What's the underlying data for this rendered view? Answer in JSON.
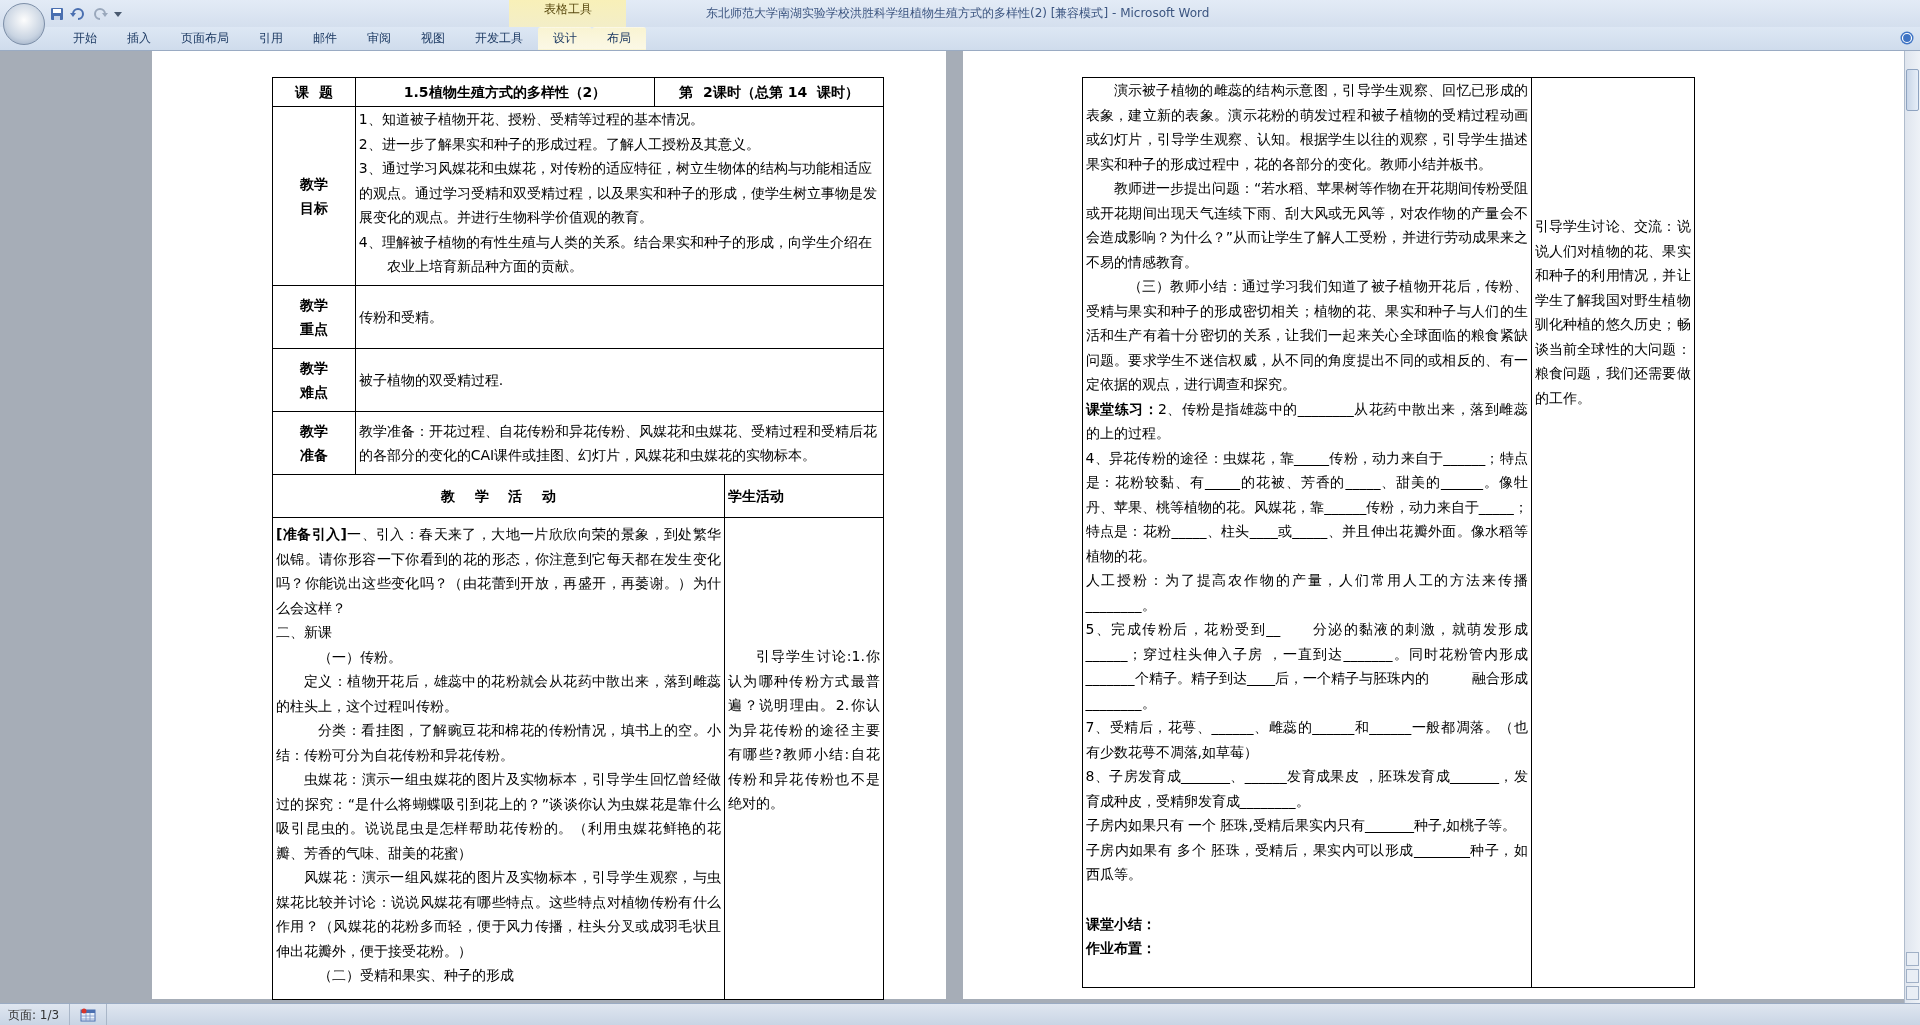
{
  "window": {
    "title": "东北师范大学南湖实验学校洪胜科学组植物生殖方式的多样性(2) [兼容模式] - Microsoft Word"
  },
  "contextual_tab_group": "表格工具",
  "ribbon_tabs": [
    {
      "label": "开始",
      "selected": false
    },
    {
      "label": "插入",
      "selected": false
    },
    {
      "label": "页面布局",
      "selected": false
    },
    {
      "label": "引用",
      "selected": false
    },
    {
      "label": "邮件",
      "selected": false
    },
    {
      "label": "审阅",
      "selected": false
    },
    {
      "label": "视图",
      "selected": false
    },
    {
      "label": "开发工具",
      "selected": false
    },
    {
      "label": "设计",
      "selected": false
    },
    {
      "label": "布局",
      "selected": false
    }
  ],
  "left_page": {
    "topic_label": "课  题",
    "topic": "1.5植物生殖方式的多样性（2）",
    "lesson": "第  2课时（总第 14  课时）",
    "rows": [
      {
        "label": "教学目标",
        "items": [
          "1、知道被子植物开花、授粉、受精等过程的基本情况。",
          "2、进一步了解果实和种子的形成过程。了解人工授粉及其意义。",
          "3、通过学习风媒花和虫媒花，对传粉的适应特征，树立生物体的结构与功能相适应的观点。通过学习受精和双受精过程，以及果实和种子的形成，使学生树立事物是发展变化的观点。并进行生物科学价值观的教育。",
          "4、理解被子植物的有性生殖与人类的关系。结合果实和种子的形成，向学生介绍在农业上培育新品种方面的贡献。"
        ]
      },
      {
        "label": "教学重点",
        "items": [
          "传粉和受精。"
        ]
      },
      {
        "label": "教学难点",
        "items": [
          "被子植物的双受精过程."
        ]
      },
      {
        "label": "教学准备",
        "items": [
          "教学准备：开花过程、自花传粉和异花传粉、风媒花和虫媒花、受精过程和受精后花的各部分的变化的CAI课件或挂图、幻灯片，风媒花和虫媒花的实物标本。"
        ]
      }
    ],
    "activity_header": "教    学    活    动",
    "student_header": "学生活动",
    "activity": [
      {
        "kind": "plain",
        "text": "**[准备引入]**一、引入：春天来了，大地一片欣欣向荣的景象，到处繁华似锦。请你形容一下你看到的花的形态，你注意到它每天都在发生变化吗？你能说出这些变化吗？（由花蕾到开放，再盛开，再萎谢。）为什么会这样？"
      },
      {
        "kind": "plain",
        "text": "二、新课"
      },
      {
        "kind": "indent_deep",
        "text": "（一）传粉。"
      },
      {
        "kind": "indent",
        "text": "定义：植物开花后，雄蕊中的花粉就会从花药中散出来，落到雌蕊的柱头上，这个过程叫传粉。"
      },
      {
        "kind": "indent_deep",
        "text": "分类：看挂图，了解豌豆花和棉花的传粉情况，填书上的空。小结：传粉可分为自花传粉和异花传粉。"
      },
      {
        "kind": "indent",
        "text": "虫媒花：演示一组虫媒花的图片及实物标本，引导学生回忆曾经做过的探究：“是什么将蝴蝶吸引到花上的？”谈谈你认为虫媒花是靠什么吸引昆虫的。说说昆虫是怎样帮助花传粉的。（利用虫媒花鲜艳的花瓣、芳香的气味、甜美的花蜜）"
      },
      {
        "kind": "indent",
        "text": "风媒花：演示一组风媒花的图片及实物标本，引导学生观察，与虫媒花比较并讨论：说说风媒花有哪些特点。这些特点对植物传粉有什么作用？（风媒花的花粉多而轻，便于风力传播，柱头分叉或成羽毛状且伸出花瓣外，便于接受花粉。）"
      },
      {
        "kind": "indent_deep",
        "text": "（二）受精和果实、种子的形成"
      }
    ],
    "student": "引导学生讨论:1.你认为哪种传粉方式最普遍？说明理由。2.你认为异花传粉的途径主要有哪些?教师小结:自花传粉和异花传粉也不是绝对的。"
  },
  "right_page": {
    "activity": [
      {
        "kind": "indent",
        "text": "演示被子植物的雌蕊的结构示意图，引导学生观察、回忆已形成的表象，建立新的表象。演示花粉的萌发过程和被子植物的受精过程动画或幻灯片，引导学生观察、认知。根据学生以往的观察，引导学生描述果实和种子的形成过程中，花的各部分的变化。教师小结并板书。"
      },
      {
        "kind": "indent",
        "text": "教师进一步提出问题：“若水稻、苹果树等作物在开花期间传粉受阻或开花期间出现天气连续下雨、刮大风或无风等，对农作物的产量会不会造成影响？为什么？”从而让学生了解人工受粉，并进行劳动成果来之不易的情感教育。"
      },
      {
        "kind": "indent_deep",
        "text": "（三）教师小结：通过学习我们知道了被子植物开花后，传粉、受精与果实和种子的形成密切相关；植物的花、果实和种子与人们的生活和生产有着十分密切的关系，让我们一起来关心全球面临的粮食紧缺问题。要求学生不迷信权威，从不同的角度提出不同的或相反的、有一定依据的观点，进行调查和探究。"
      },
      {
        "kind": "plain",
        "text": "**课堂练习：**2、传粉是指雄蕊中的________从花药中散出来，落到雌蕊的上的过程。"
      },
      {
        "kind": "plain",
        "text": "4、异花传粉的途径：虫媒花，靠_____传粉，动力来自于______；特点是：花粉较黏、有_____的花被、芳香的_____、甜美的______。像牡丹、苹果、桃等植物的花。风媒花，靠______传粉，动力来自于_____；特点是：花粉_____、柱头____或_____、并且伸出花瓣外面。像水稻等植物的花。"
      },
      {
        "kind": "plain",
        "text": "人工授粉：为了提高农作物的产量，人们常用人工的方法来传播________。"
      },
      {
        "kind": "plain",
        "text": "5、完成传粉后，花粉受到__　　分泌的黏液的刺激，就萌发形成______；穿过柱头伸入子房 ，一直到达_______。同时花粉管内形成_______个精子。精子到达____后，一个精子与胚珠内的　　　融合形成________。"
      },
      {
        "kind": "plain",
        "text": "7、受精后，花萼、______、雌蕊的______和______一般都凋落。（也有少数花萼不凋落,如草莓）"
      },
      {
        "kind": "plain",
        "text": "8、子房发育成_______、______发育成果皮 ，胚珠发育成_______，发育成种皮，受精卵发育成________。"
      },
      {
        "kind": "plain",
        "text": "子房内如果只有 一个 胚珠,受精后果实内只有_______种子,如桃子等。"
      },
      {
        "kind": "plain",
        "text": "子房内如果有 多个 胚珠，受精后，果实内可以形成________种子，如西瓜等。"
      },
      {
        "kind": "bold_gap",
        "text": "课堂小结："
      },
      {
        "kind": "bold",
        "text": "作业布置："
      }
    ],
    "student": "引导学生讨论、交流：说说人们对植物的花、果实和种子的利用情况，并让学生了解我国对野生植物驯化种植的悠久历史；畅谈当前全球性的大问题：粮食问题，我们还需要做的工作。"
  },
  "status_bar": {
    "page": "页面: 1/3"
  }
}
